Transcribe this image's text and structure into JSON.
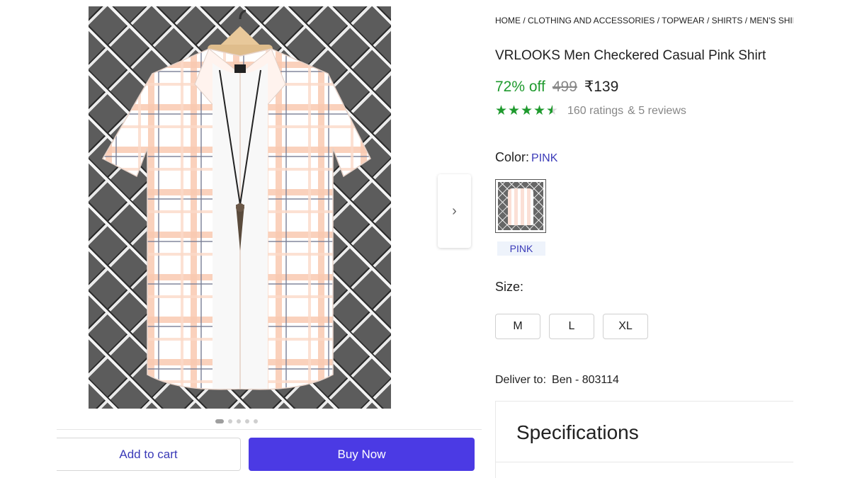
{
  "breadcrumb": "HOME / CLOTHING AND ACCESSORIES / TOPWEAR / SHIRTS / MEN'S SHIRTS",
  "product": {
    "title": "VRLOOKS Men Checkered Casual Pink Shirt",
    "discount": "72% off",
    "mrp": "499",
    "price": "₹139",
    "rating_value": 4.5,
    "ratings_text": "160 ratings",
    "reviews_text": "& 5 reviews"
  },
  "color": {
    "label": "Color:",
    "selected": "PINK",
    "swatch_caption": "PINK"
  },
  "size": {
    "label": "Size:",
    "options": [
      "M",
      "L",
      "XL"
    ]
  },
  "delivery": {
    "label": "Deliver to:",
    "who": "Ben - 803114"
  },
  "specifications": {
    "title": "Specifications"
  },
  "actions": {
    "add_to_cart": "Add to cart",
    "buy_now": "Buy Now"
  },
  "gallery": {
    "image_count": 5,
    "active_index": 0,
    "next_icon": "chevron-right-icon"
  },
  "colors": {
    "accent": "#4b3ae4",
    "discount_green": "#1f9a2e",
    "link_blue": "#3a3ab8"
  }
}
